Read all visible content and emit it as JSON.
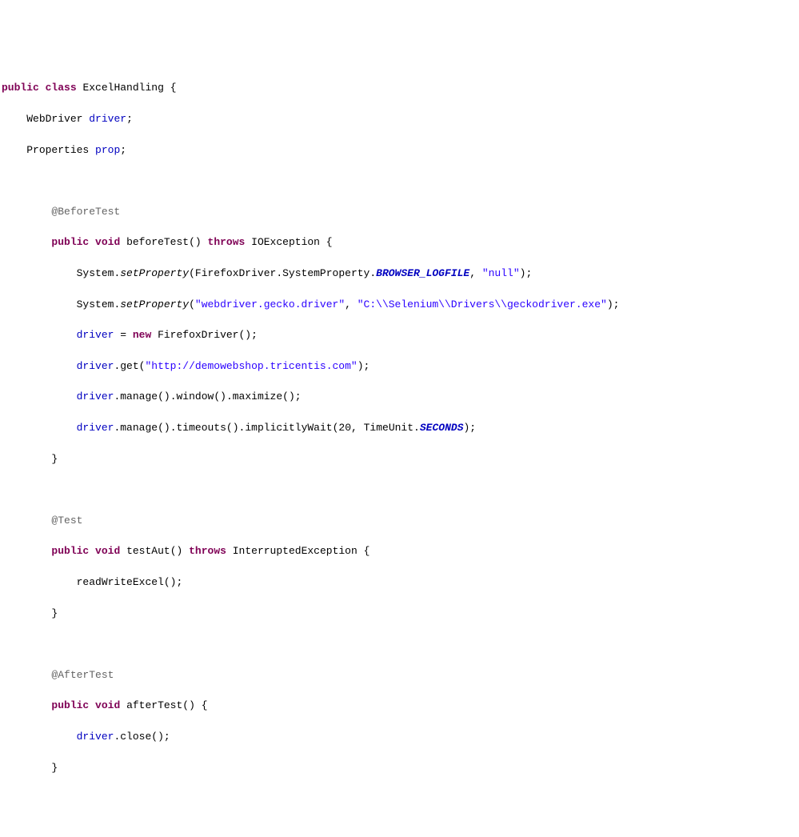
{
  "code": {
    "public": "public",
    "class_kw": "class",
    "class_name": "ExcelHandling",
    "lbrace": "{",
    "rbrace": "}",
    "webdriver_type": "WebDriver",
    "driver_field": "driver",
    "semicolon": ";",
    "properties_type": "Properties",
    "prop_field": "prop",
    "ann_before_test": "@BeforeTest",
    "void_kw": "void",
    "before_test_name": "beforeTest",
    "throws_kw": "throws",
    "ioexception": "IOException",
    "system": "System",
    "dot": ".",
    "set_property": "setProperty",
    "lparen": "(",
    "rparen": ")",
    "firefox_driver": "FirefoxDriver",
    "system_property": "SystemProperty",
    "browser_logfile": "BROWSER_LOGFILE",
    "comma": ",",
    "str_null": "\"null\"",
    "str_gecko_key": "\"webdriver.gecko.driver\"",
    "str_gecko_path": "\"C:\\\\Selenium\\\\Drivers\\\\geckodriver.exe\"",
    "driver": "driver",
    "equals": " = ",
    "new_kw": "new",
    "get_method": "get",
    "str_url": "\"http://demowebshop.tricentis.com\"",
    "manage": "manage",
    "window": "window",
    "maximize": "maximize",
    "timeouts": "timeouts",
    "implicitly_wait": "implicitlyWait",
    "num_20": "20",
    "timeunit": "TimeUnit",
    "seconds": "SECONDS",
    "ann_test": "@Test",
    "test_aut_name": "testAut",
    "interrupted_exception": "InterruptedException",
    "read_write_excel": "readWriteExcel",
    "ann_after_test": "@AfterTest",
    "after_test_name": "afterTest",
    "close": "close"
  }
}
